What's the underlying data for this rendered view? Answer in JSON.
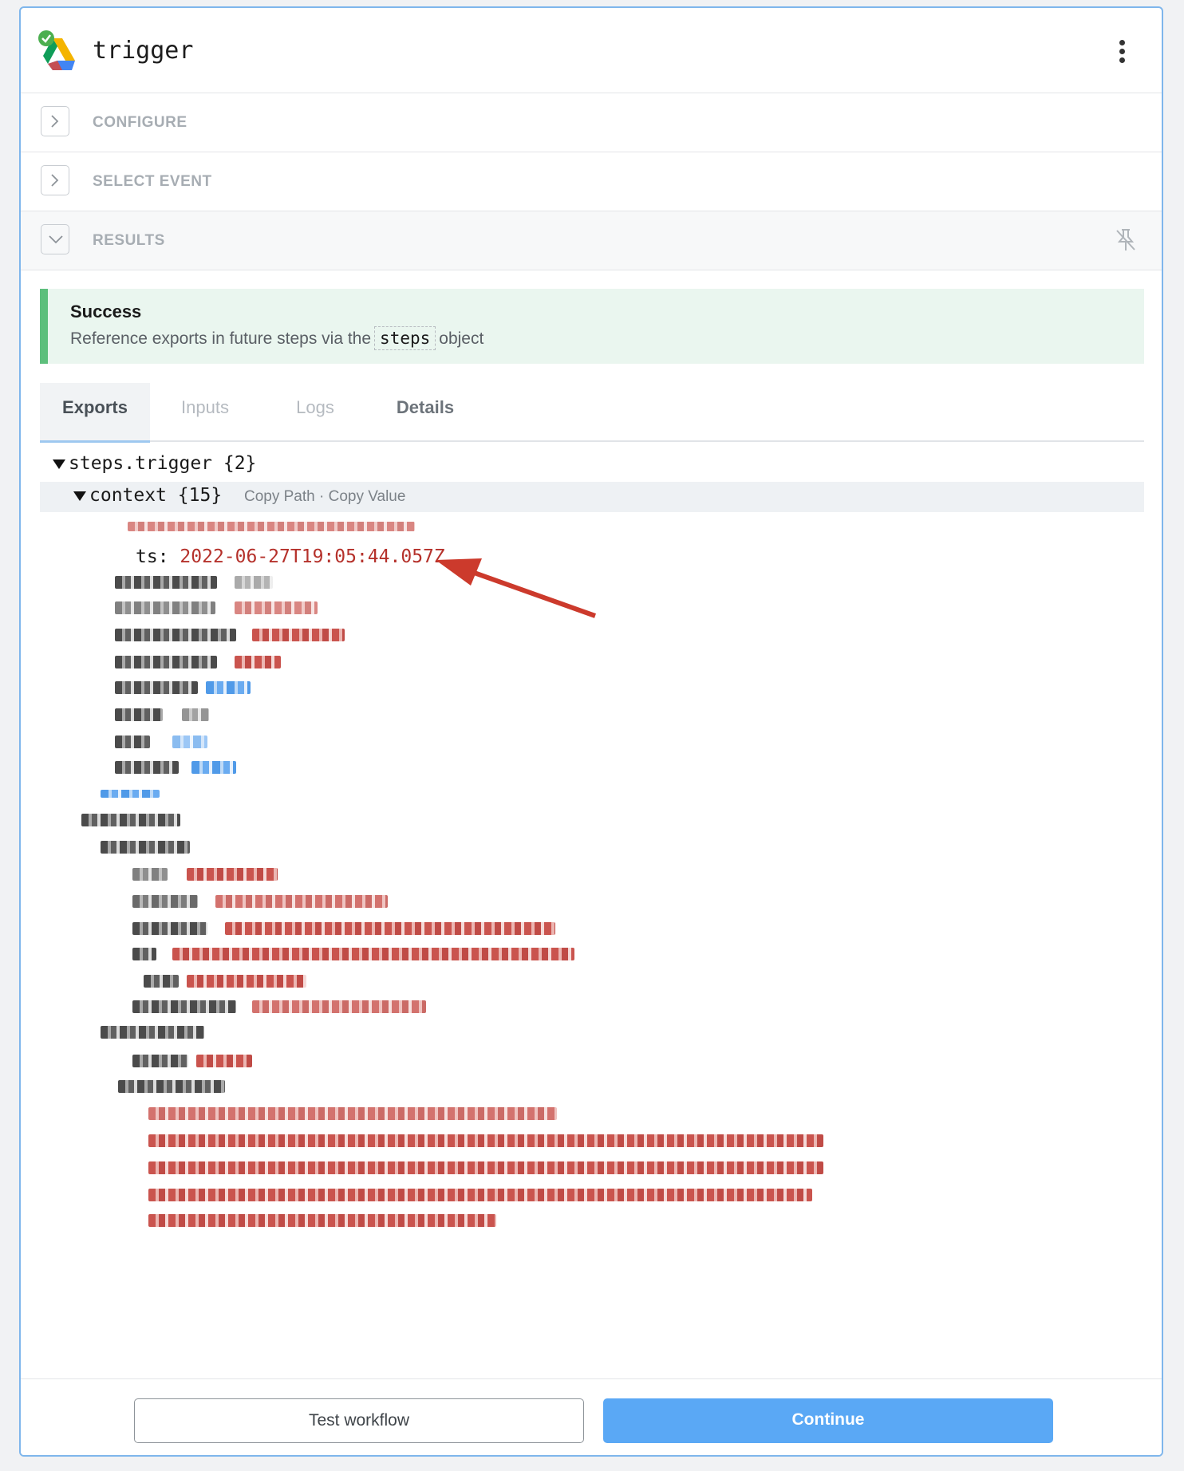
{
  "header": {
    "title": "trigger",
    "app_icon": "google-drive-icon",
    "menu_icon": "kebab-menu-icon"
  },
  "sections": [
    {
      "label": "CONFIGURE",
      "state": "collapsed"
    },
    {
      "label": "SELECT EVENT",
      "state": "collapsed"
    },
    {
      "label": "RESULTS",
      "state": "expanded"
    }
  ],
  "alert": {
    "title": "Success",
    "prefix": "Reference exports in future steps via the",
    "code": "steps",
    "suffix": "object",
    "accent": "#5dbf7c"
  },
  "tabs": [
    {
      "label": "Exports",
      "active": true
    },
    {
      "label": "Inputs"
    },
    {
      "label": "Logs"
    },
    {
      "label": "Details"
    }
  ],
  "tree": {
    "root": "steps.trigger {2}",
    "context": "context {15}",
    "copy_path": "Copy Path",
    "separator": "·",
    "copy_value": "Copy Value",
    "ts_key": "ts:",
    "ts_value": "2022-06-27T19:05:44.057Z"
  },
  "footer": {
    "test_label": "Test workflow",
    "continue_label": "Continue"
  },
  "colors": {
    "accent_blue": "#5aa8f5",
    "value_red": "#b5312b",
    "panel_border": "#7fb6ec"
  }
}
